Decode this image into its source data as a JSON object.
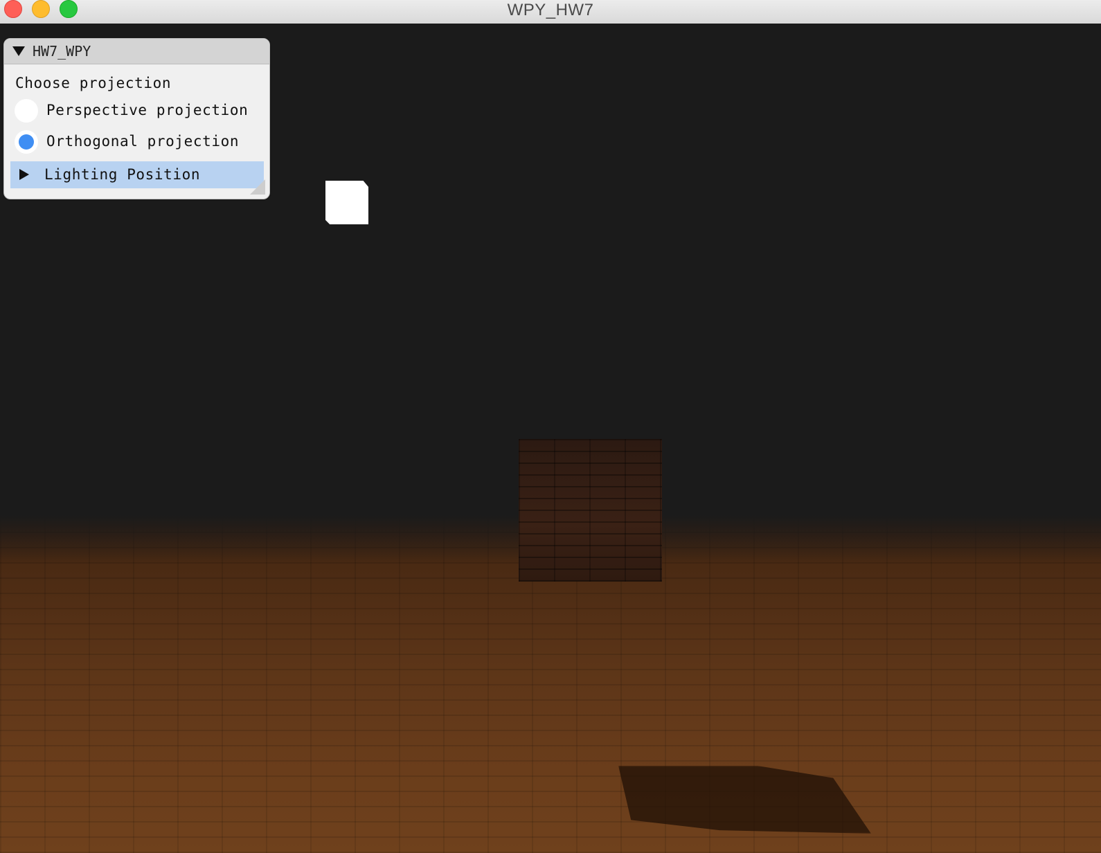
{
  "window": {
    "title": "WPY_HW7"
  },
  "panel": {
    "title": "HW7_WPY",
    "section_label": "Choose projection",
    "options": [
      {
        "label": "Perspective projection",
        "selected": false
      },
      {
        "label": "Orthogonal projection",
        "selected": true
      }
    ],
    "collapsed_node": "Lighting Position"
  },
  "colors": {
    "background": "#1b1b1b",
    "radio_selected": "#3f8ef3",
    "node_highlight": "#b8d2f1",
    "floor": "#5c3518"
  },
  "icons": {
    "panel_collapse": "triangle-down-icon",
    "node_expand": "triangle-right-icon"
  }
}
